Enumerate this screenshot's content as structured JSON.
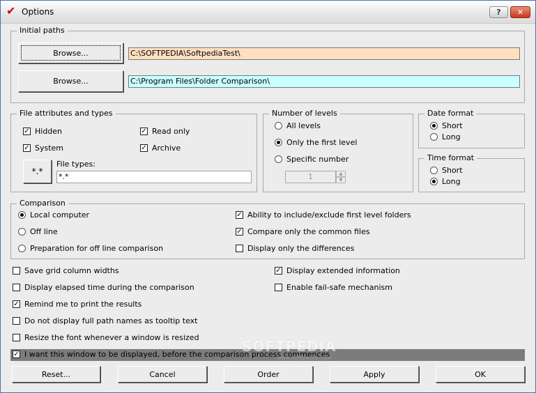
{
  "window": {
    "title": "Options",
    "help_label": "?",
    "close_label": "✕"
  },
  "initial_paths": {
    "legend": "Initial paths",
    "rows": [
      {
        "button": "Browse...",
        "path": "C:\\SOFTPEDIA\\SoftpediaTest\\",
        "color": "#ffdfbf"
      },
      {
        "button": "Browse...",
        "path": "C:\\Program Files\\Folder Comparison\\",
        "color": "#c8ffff"
      }
    ]
  },
  "file_attributes": {
    "legend": "File attributes and types",
    "hidden": {
      "label": "Hidden",
      "checked": true
    },
    "read_only": {
      "label": "Read only",
      "checked": true
    },
    "system": {
      "label": "System",
      "checked": true
    },
    "archive": {
      "label": "Archive",
      "checked": true
    },
    "types_button": "*.*",
    "file_types_label": "File types:",
    "file_types_value": "*.*"
  },
  "levels": {
    "legend": "Number of levels",
    "all": "All levels",
    "first": "Only the first level",
    "specific": "Specific number",
    "selected": "first",
    "spin_value": "1"
  },
  "date_format": {
    "legend": "Date format",
    "short": "Short",
    "long": "Long",
    "selected": "short"
  },
  "time_format": {
    "legend": "Time format",
    "short": "Short",
    "long": "Long",
    "selected": "long"
  },
  "comparison": {
    "legend": "Comparison",
    "local": "Local computer",
    "offline": "Off line",
    "prep": "Preparation for off line comparison",
    "selected": "local",
    "include_exclude": {
      "label": "Ability to include/exclude first level folders",
      "checked": true
    },
    "common_files": {
      "label": "Compare only the common files",
      "checked": true
    },
    "differences": {
      "label": "Display only the differences",
      "checked": false
    }
  },
  "options": {
    "save_grid": {
      "label": "Save grid column widths",
      "checked": false
    },
    "elapsed": {
      "label": "Display elapsed time during the comparison",
      "checked": false
    },
    "remind": {
      "label": "Remind me to print the results",
      "checked": true
    },
    "no_full_path": {
      "label": "Do not display full path names as tooltip text",
      "checked": false
    },
    "resize_font": {
      "label": "Resize the font whenever a window is resized",
      "checked": false
    },
    "show_before": {
      "label": "I want this window to be displayed, before the comparison process commences",
      "checked": true
    },
    "extended_info": {
      "label": "Display extended information",
      "checked": true
    },
    "fail_safe": {
      "label": "Enable fail-safe mechanism",
      "checked": false
    }
  },
  "buttons": {
    "reset": "Reset...",
    "cancel": "Cancel",
    "order": "Order",
    "apply": "Apply",
    "ok": "OK"
  },
  "watermark": {
    "text": "SOFTPEDIA",
    "url": "www.softpedia.com"
  }
}
